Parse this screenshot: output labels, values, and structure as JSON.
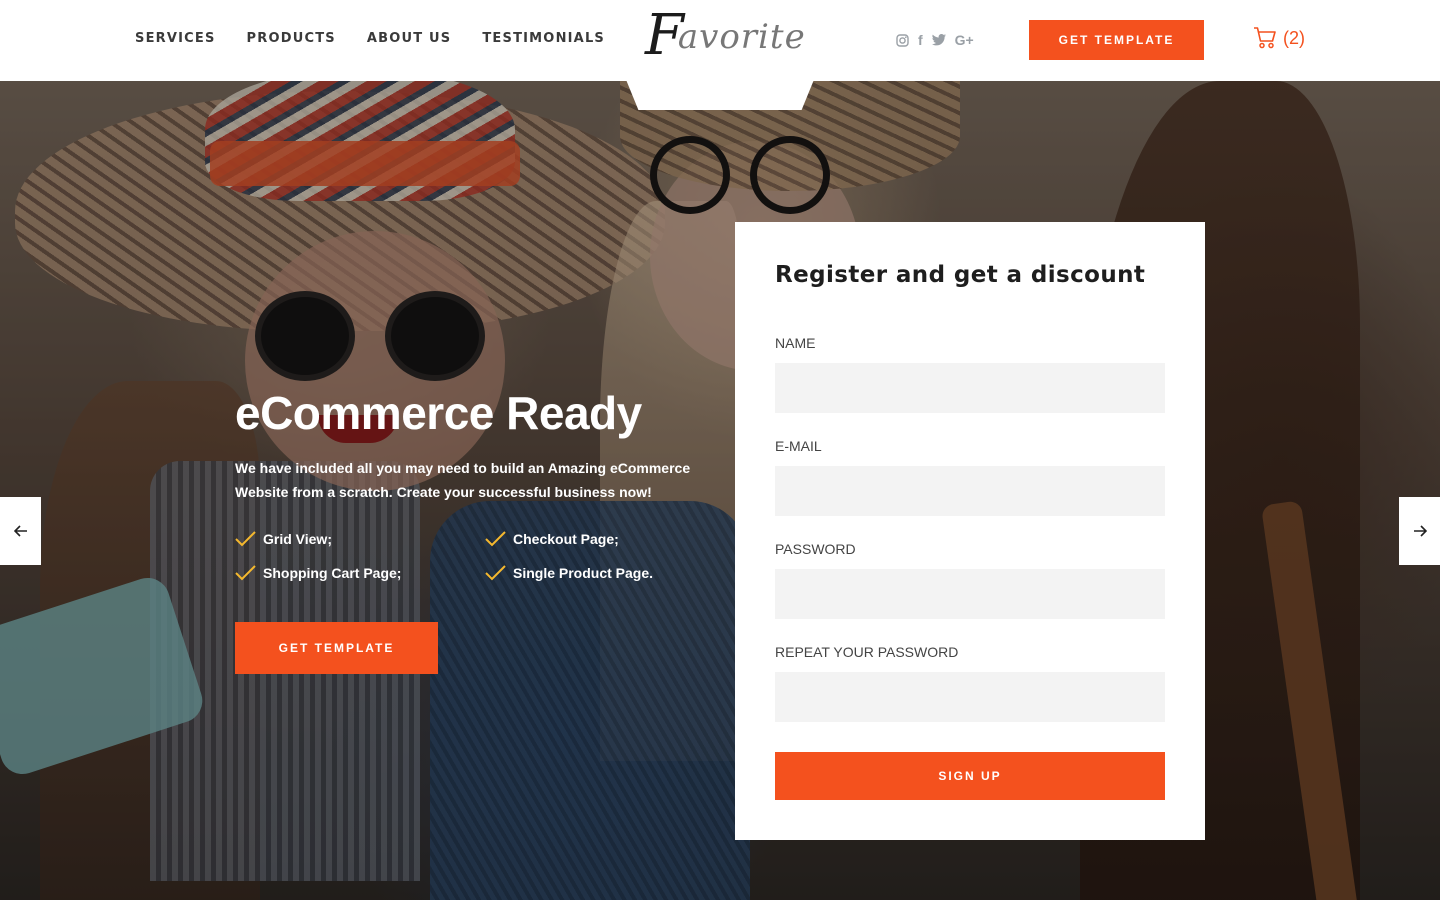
{
  "nav": {
    "items": [
      "SERVICES",
      "PRODUCTS",
      "ABOUT US",
      "TESTIMONIALS"
    ]
  },
  "logo": {
    "first_letter": "F",
    "rest": "avorite"
  },
  "social": {
    "icons": [
      "instagram-icon",
      "facebook-icon",
      "twitter-icon",
      "google-plus-icon"
    ],
    "facebook_glyph": "f",
    "google_plus_glyph": "G+"
  },
  "header": {
    "cta_label": "GET TEMPLATE"
  },
  "cart": {
    "count_label": "(2)",
    "icon": "cart-icon"
  },
  "hero": {
    "title": "eCommerce Ready",
    "description": "We have included all you may need to build an Amazing eCommerce Website from a scratch. Create your successful business now!",
    "features": [
      "Grid View;",
      "Checkout Page;",
      "Shopping Cart Page;",
      "Single Product Page."
    ],
    "cta_label": "GET TEMPLATE"
  },
  "slider": {
    "prev_icon": "arrow-left-icon",
    "next_icon": "arrow-right-icon"
  },
  "form": {
    "title": "Register and get a discount",
    "fields": [
      {
        "label": "NAME",
        "value": ""
      },
      {
        "label": "E-MAIL",
        "value": ""
      },
      {
        "label": "PASSWORD",
        "value": ""
      },
      {
        "label": "REPEAT YOUR PASSWORD",
        "value": ""
      }
    ],
    "submit_label": "SIGN UP"
  },
  "colors": {
    "accent": "#f4511e",
    "check": "#f5b82e",
    "nav_text": "#3a3a3a",
    "field_bg": "#f3f3f3"
  }
}
